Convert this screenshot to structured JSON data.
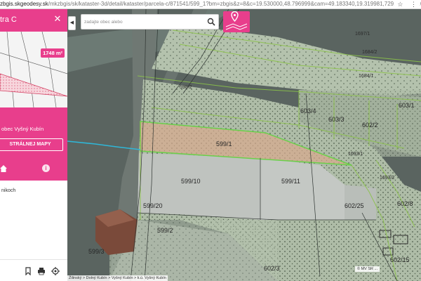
{
  "browser": {
    "url_domain": "zbgis.skgeodesy.sk",
    "url_path": "/mkzbgis/sk/kataster-3d/detail/kataster/parcela-c/871541/599_1?bm=zbgis&z=8&c=19.530000,48.796999&cam=49.183340,19.319981,729.225045,0.000525,44.99..."
  },
  "sidebar": {
    "title": "tra C",
    "area_badge": "1748 m²",
    "location": "obec Vyšný Kubín",
    "map_button": "STRÁLNEJ MAPY",
    "list_text": "nikoch"
  },
  "search": {
    "placeholder": "zadajte obec alebo"
  },
  "map": {
    "parcel_labels": [
      "599/1",
      "599/10",
      "599/11",
      "599/2",
      "599/3",
      "599/20",
      "602/3",
      "603/4",
      "603/3",
      "603/1",
      "602/2",
      "602/25",
      "602/8",
      "602/15",
      "598/2",
      "1684/1",
      "1684/2",
      "1693/1",
      "1693/2",
      "1697/1"
    ],
    "attribution_left": "Žilinský > Dolný Kubín > Vyšný Kubín > k.ú. Vyšný Kubín",
    "attribution_right": "© MV SR ..."
  },
  "colors": {
    "accent": "#e83e8c",
    "parcel_highlight": "#6ad04a"
  }
}
